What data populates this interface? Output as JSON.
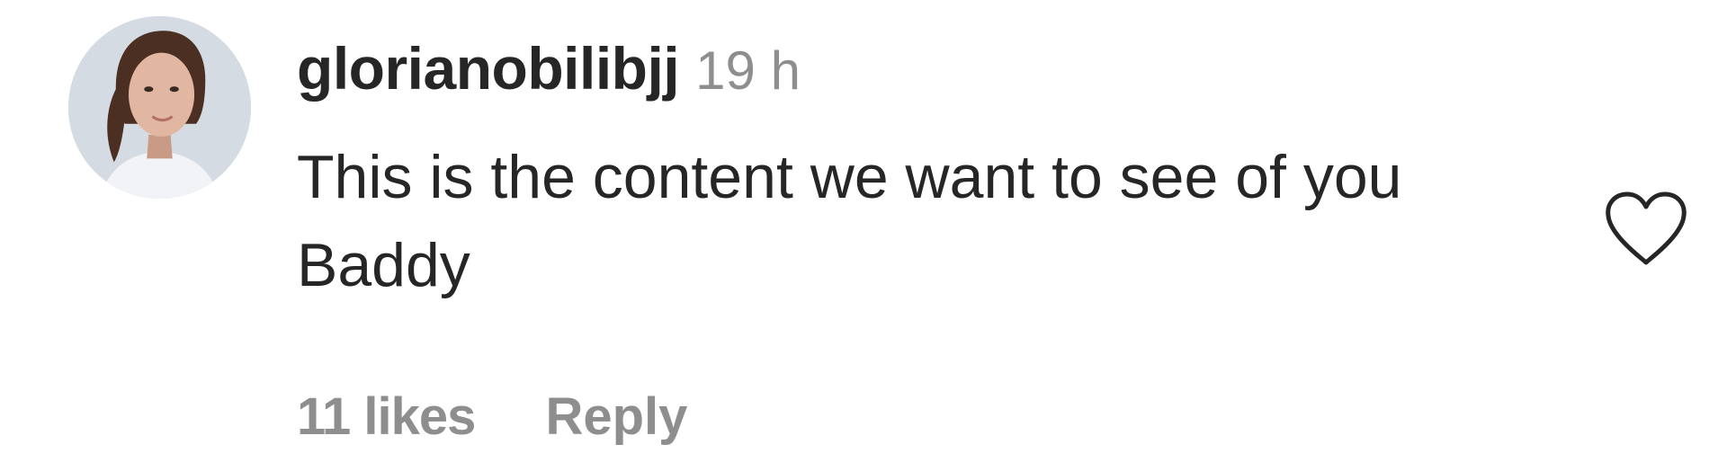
{
  "comment": {
    "avatar": {
      "icon": "user-avatar-photo",
      "background_color": "#d4dbe2"
    },
    "username": "glorianobilibjj",
    "timestamp": "19 h",
    "text": "This is the content we want to see of you Baddy",
    "footer": {
      "likes_label": "11 likes",
      "reply_label": "Reply"
    },
    "like_icon": "heart-outline-icon"
  },
  "colors": {
    "primary_text": "#262626",
    "secondary_text": "#8e8e8e",
    "background": "#ffffff"
  }
}
